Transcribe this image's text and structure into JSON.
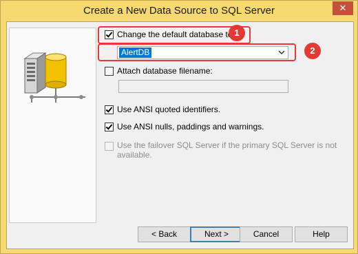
{
  "window": {
    "title": "Create a New Data Source to SQL Server",
    "close_glyph": "✕"
  },
  "options": {
    "change_default_db": {
      "label": "Change the default database to:",
      "checked": true
    },
    "database_select": {
      "value": "AlertDB"
    },
    "attach_db": {
      "label": "Attach database filename:",
      "checked": false
    },
    "attach_filename": {
      "value": ""
    },
    "ansi_quoted": {
      "label": "Use ANSI quoted identifiers.",
      "checked": true
    },
    "ansi_nulls": {
      "label": "Use ANSI nulls, paddings and warnings.",
      "checked": true
    },
    "failover": {
      "label_line1": "Use the failover SQL Server if the primary SQL Server is not",
      "label_line2": "available.",
      "checked": false,
      "disabled": true
    }
  },
  "annotations": {
    "badge1": "1",
    "badge2": "2"
  },
  "buttons": {
    "back": "< Back",
    "next": "Next >",
    "cancel": "Cancel",
    "help": "Help"
  },
  "colors": {
    "callout": "#e53935",
    "title_bar": "#f7d971",
    "selection": "#0078d7"
  },
  "icons": {
    "art": "database-server-network-icon",
    "dropdown": "chevron-down-icon"
  }
}
